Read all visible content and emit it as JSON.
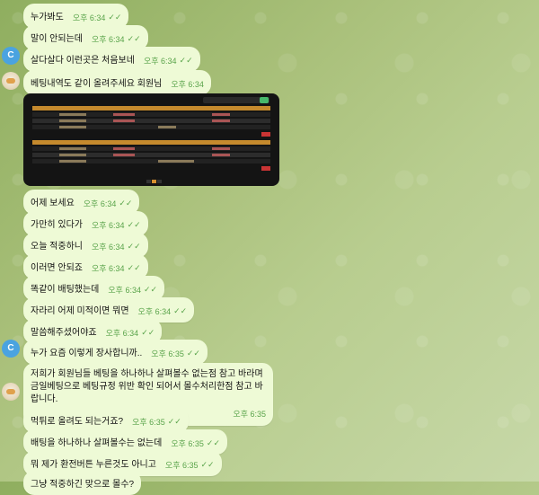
{
  "messages": [
    {
      "text": "누가봐도",
      "time": "오후 6:34"
    },
    {
      "text": "말이 안되는데",
      "time": "오후 6:34"
    },
    {
      "text": "살다살다 이런곳은 처음보네",
      "time": "오후 6:34"
    },
    {
      "text": "베팅내역도 같이 올려주세요 회원님",
      "time": "오후 6:34"
    },
    {
      "text": "어제 보세요",
      "time": "오후 6:34"
    },
    {
      "text": "가만히 있다가",
      "time": "오후 6:34"
    },
    {
      "text": "오늘 적중하니",
      "time": "오후 6:34"
    },
    {
      "text": "이러면 안되죠",
      "time": "오후 6:34"
    },
    {
      "text": "똑같이 배팅했는데",
      "time": "오후 6:34"
    },
    {
      "text": "자라리 어제 미적이면 뭐면",
      "time": "오후 6:34"
    },
    {
      "text": "말씀해주셨어야죠",
      "time": "오후 6:34"
    },
    {
      "text": "누가 요즘 이렇게 장사합니까..",
      "time": "오후 6:35"
    },
    {
      "text": "저희가 회원님들 베팅을 하나하나 살펴볼수 없는점 참고 바라며 금일베팅으로 베팅규정 위반 확인 되어서 몰수처리한점 참고 바랍니다.",
      "time": "오후 6:35"
    },
    {
      "text": "먹튀로 올려도 되는거죠?",
      "time": "오후 6:35"
    },
    {
      "text": "배팅을 하나하나 살펴볼수는 없는데",
      "time": "오후 6:35"
    },
    {
      "text": "뭐 제가 환전버튼 누른것도 아니고",
      "time": "오후 6:35"
    },
    {
      "text": "그냥 적중하긴 맞으로 몰수?",
      "time": ""
    }
  ],
  "avatars": {
    "c_letter": "C"
  },
  "colors": {
    "bubble": "#eefad6",
    "check": "#5aa44b"
  }
}
